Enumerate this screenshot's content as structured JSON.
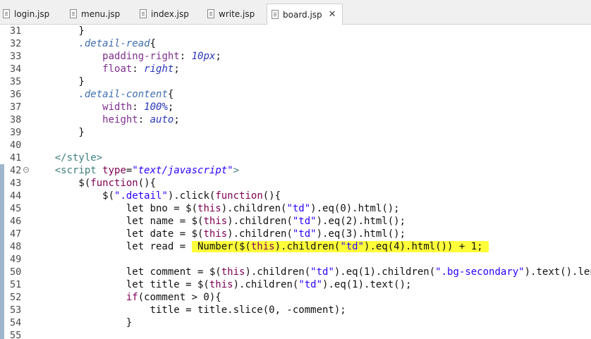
{
  "tabs": [
    {
      "label": "login.jsp",
      "active": false
    },
    {
      "label": "menu.jsp",
      "active": false
    },
    {
      "label": "index.jsp",
      "active": false
    },
    {
      "label": "write.jsp",
      "active": false
    },
    {
      "label": "board.jsp",
      "active": true
    }
  ],
  "close_icon": "close-icon",
  "highlight_color": "#ffff3a",
  "lines": [
    {
      "num": "31",
      "segs": [
        {
          "t": "        }"
        }
      ]
    },
    {
      "num": "32",
      "segs": [
        {
          "t": "        "
        },
        {
          "t": ".detail-read",
          "c": "sel"
        },
        {
          "t": "{"
        }
      ]
    },
    {
      "num": "33",
      "segs": [
        {
          "t": "            "
        },
        {
          "t": "padding-right",
          "c": "prop"
        },
        {
          "t": ": "
        },
        {
          "t": "10px",
          "c": "val"
        },
        {
          "t": ";"
        }
      ]
    },
    {
      "num": "34",
      "segs": [
        {
          "t": "            "
        },
        {
          "t": "float",
          "c": "prop"
        },
        {
          "t": ": "
        },
        {
          "t": "right",
          "c": "val"
        },
        {
          "t": ";"
        }
      ]
    },
    {
      "num": "35",
      "segs": [
        {
          "t": "        }"
        }
      ]
    },
    {
      "num": "36",
      "segs": [
        {
          "t": "        "
        },
        {
          "t": ".detail-content",
          "c": "sel"
        },
        {
          "t": "{"
        }
      ]
    },
    {
      "num": "37",
      "segs": [
        {
          "t": "            "
        },
        {
          "t": "width",
          "c": "prop"
        },
        {
          "t": ": "
        },
        {
          "t": "100%",
          "c": "val"
        },
        {
          "t": ";"
        }
      ]
    },
    {
      "num": "38",
      "segs": [
        {
          "t": "            "
        },
        {
          "t": "height",
          "c": "prop"
        },
        {
          "t": ": "
        },
        {
          "t": "auto",
          "c": "val"
        },
        {
          "t": ";"
        }
      ]
    },
    {
      "num": "39",
      "segs": [
        {
          "t": "        }"
        }
      ]
    },
    {
      "num": "40",
      "segs": []
    },
    {
      "num": "41",
      "segs": [
        {
          "t": "    "
        },
        {
          "t": "</style>",
          "c": "tag"
        }
      ]
    },
    {
      "num": "42",
      "fold": true,
      "segs": [
        {
          "t": "    "
        },
        {
          "t": "<script ",
          "c": "tag"
        },
        {
          "t": "type",
          "c": "attr"
        },
        {
          "t": "="
        },
        {
          "t": "\"text/javascript\"",
          "c": "strq"
        },
        {
          "t": ">",
          "c": "tag"
        }
      ]
    },
    {
      "num": "43",
      "segs": [
        {
          "t": "        $("
        },
        {
          "t": "function",
          "c": "kw"
        },
        {
          "t": "(){"
        }
      ]
    },
    {
      "num": "44",
      "segs": [
        {
          "t": "            $("
        },
        {
          "t": "\".detail\"",
          "c": "str"
        },
        {
          "t": ").click("
        },
        {
          "t": "function",
          "c": "kw"
        },
        {
          "t": "(){"
        }
      ]
    },
    {
      "num": "45",
      "segs": [
        {
          "t": "                let bno = $("
        },
        {
          "t": "this",
          "c": "kw"
        },
        {
          "t": ").children("
        },
        {
          "t": "\"td\"",
          "c": "str"
        },
        {
          "t": ").eq(0).html();"
        }
      ]
    },
    {
      "num": "46",
      "segs": [
        {
          "t": "                let name = $("
        },
        {
          "t": "this",
          "c": "kw"
        },
        {
          "t": ").children("
        },
        {
          "t": "\"td\"",
          "c": "str"
        },
        {
          "t": ").eq(2).html();"
        }
      ]
    },
    {
      "num": "47",
      "segs": [
        {
          "t": "                let date = $("
        },
        {
          "t": "this",
          "c": "kw"
        },
        {
          "t": ").children("
        },
        {
          "t": "\"td\"",
          "c": "str"
        },
        {
          "t": ").eq(3).html();"
        }
      ]
    },
    {
      "num": "48",
      "segs": [
        {
          "t": "                let read = "
        },
        {
          "t": " Number($(",
          "h": true
        },
        {
          "t": "this",
          "c": "kw",
          "h": true
        },
        {
          "t": ").children(",
          "h": true
        },
        {
          "t": "\"td\"",
          "c": "str",
          "h": true
        },
        {
          "t": ").eq(4).html()) + 1; ",
          "h": true
        }
      ]
    },
    {
      "num": "49",
      "segs": []
    },
    {
      "num": "50",
      "segs": [
        {
          "t": "                let comment = $("
        },
        {
          "t": "this",
          "c": "kw"
        },
        {
          "t": ").children("
        },
        {
          "t": "\"td\"",
          "c": "str"
        },
        {
          "t": ").eq(1).children("
        },
        {
          "t": "\".bg-secondary\"",
          "c": "str"
        },
        {
          "t": ").text().length;"
        }
      ]
    },
    {
      "num": "51",
      "segs": [
        {
          "t": "                let title = $("
        },
        {
          "t": "this",
          "c": "kw"
        },
        {
          "t": ").children("
        },
        {
          "t": "\"td\"",
          "c": "str"
        },
        {
          "t": ").eq(1).text();"
        }
      ]
    },
    {
      "num": "52",
      "segs": [
        {
          "t": "                "
        },
        {
          "t": "if",
          "c": "kw"
        },
        {
          "t": "(comment > 0){"
        }
      ]
    },
    {
      "num": "53",
      "segs": [
        {
          "t": "                    title = title.slice(0, -comment);"
        }
      ]
    },
    {
      "num": "54",
      "segs": [
        {
          "t": "                }"
        }
      ]
    },
    {
      "num": "55",
      "segs": []
    }
  ]
}
